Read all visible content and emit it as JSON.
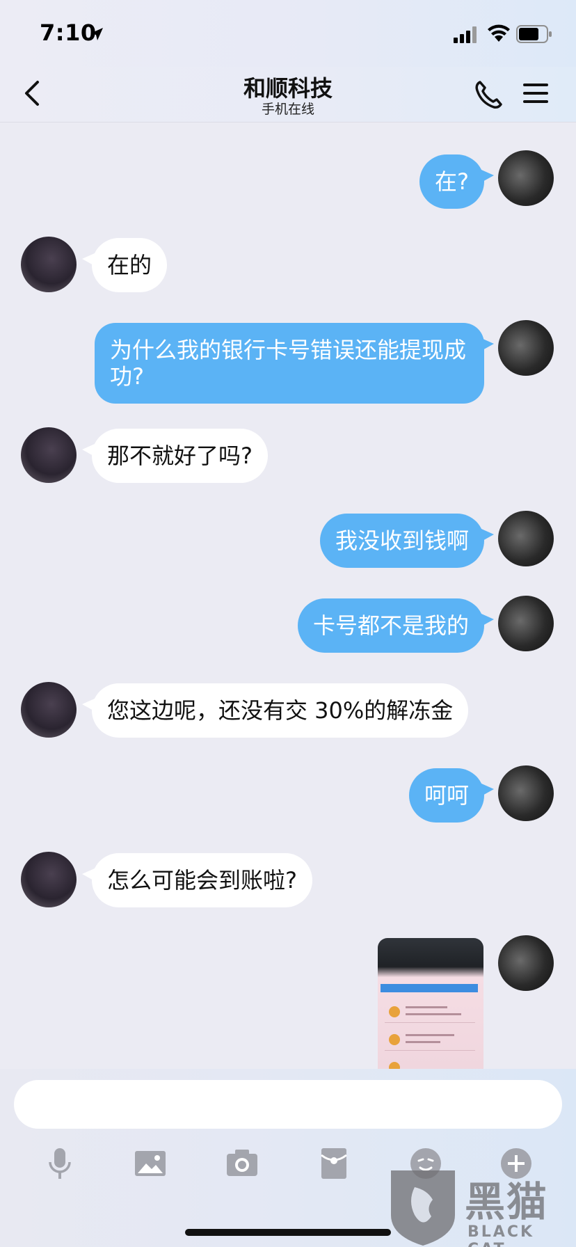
{
  "status_bar": {
    "time": "7:10"
  },
  "header": {
    "title": "和顺科技",
    "subtitle": "手机在线"
  },
  "messages": [
    {
      "side": "out",
      "text": "在?"
    },
    {
      "side": "in",
      "text": "在的"
    },
    {
      "side": "out",
      "text": "为什么我的银行卡号错误还能提现成功?"
    },
    {
      "side": "in",
      "text": "那不就好了吗?"
    },
    {
      "side": "out",
      "text": "我没收到钱啊"
    },
    {
      "side": "out",
      "text": "卡号都不是我的"
    },
    {
      "side": "in",
      "text": "您这边呢，还没有交 30%的解冻金"
    },
    {
      "side": "out",
      "text": "呵呵"
    },
    {
      "side": "in",
      "text": "怎么可能会到账啦?"
    },
    {
      "side": "out",
      "type": "image",
      "content": "photo of phone screen"
    }
  ],
  "input": {
    "placeholder": ""
  },
  "toolbar": {
    "icons": [
      "microphone-icon",
      "image-icon",
      "camera-icon",
      "red-packet-icon",
      "emoji-icon",
      "plus-icon"
    ]
  },
  "watermark": {
    "title": "黑猫",
    "subtitle": "BLACK CAT"
  },
  "colors": {
    "outgoing_bubble": "#5bb3f5",
    "incoming_bubble": "#ffffff",
    "background": "#ebebf3"
  }
}
